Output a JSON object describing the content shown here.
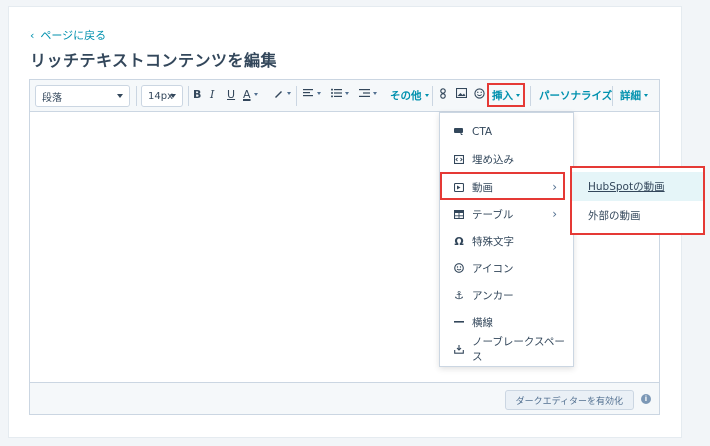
{
  "nav": {
    "back_label": "ページに戻る"
  },
  "page": {
    "title": "リッチテキストコンテンツを編集"
  },
  "toolbar": {
    "paragraph": "段落",
    "font_size": "14px",
    "bold": "B",
    "italic": "I",
    "underline": "U",
    "text_color": "A",
    "other": "その他",
    "insert": "挿入",
    "personalize": "パーソナライズ",
    "details": "詳細"
  },
  "insert_menu": {
    "items": [
      {
        "label": "CTA",
        "icon": "cta-icon"
      },
      {
        "label": "埋め込み",
        "icon": "embed-icon"
      },
      {
        "label": "動画",
        "icon": "video-icon",
        "has_submenu": true
      },
      {
        "label": "テーブル",
        "icon": "table-icon",
        "has_submenu": true
      },
      {
        "label": "特殊文字",
        "icon": "omega-icon"
      },
      {
        "label": "アイコン",
        "icon": "icon-icon"
      },
      {
        "label": "アンカー",
        "icon": "anchor-icon"
      },
      {
        "label": "横線",
        "icon": "horizontal-line-icon"
      },
      {
        "label": "ノーブレークスペース",
        "icon": "nbsp-icon"
      }
    ]
  },
  "video_submenu": {
    "items": [
      {
        "label": "HubSpotの動画"
      },
      {
        "label": "外部の動画"
      }
    ]
  },
  "footer": {
    "dark_editor_label": "ダークエディターを有効化"
  },
  "colors": {
    "accent": "#0091ae",
    "highlight_border": "#e53935",
    "text": "#33475b"
  }
}
